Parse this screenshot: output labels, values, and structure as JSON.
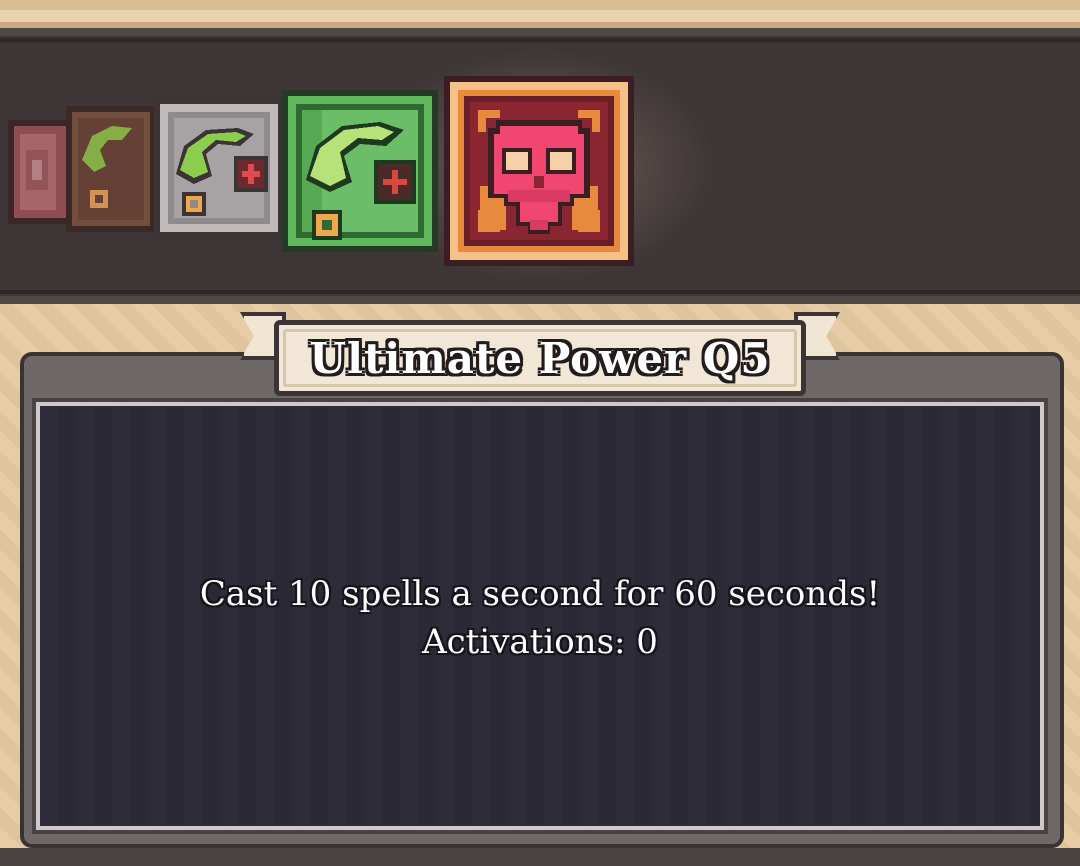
{
  "ability": {
    "title": "Ultimate Power Q5",
    "description": "Cast 10 spells a second for 60 seconds!",
    "activations_label": "Activations: 0"
  },
  "carousel": {
    "items": [
      {
        "icon": "red-book-icon",
        "state": "faded"
      },
      {
        "icon": "green-swirl-rune-icon",
        "frame": "brown",
        "state": "dim"
      },
      {
        "icon": "green-swirl-rune-icon",
        "frame": "silver",
        "state": "normal"
      },
      {
        "icon": "green-swirl-rune-icon",
        "frame": "green",
        "state": "normal"
      },
      {
        "icon": "pink-skull-icon",
        "frame": "orange",
        "state": "selected"
      }
    ]
  },
  "colors": {
    "panel_bg": "#2b2a36",
    "carousel_bg": "#3d3536",
    "parchment": "#e6cba3",
    "skull": "#e23d6c",
    "rune_green": "#8fce5a",
    "selected_frame": "#f29a4c"
  }
}
